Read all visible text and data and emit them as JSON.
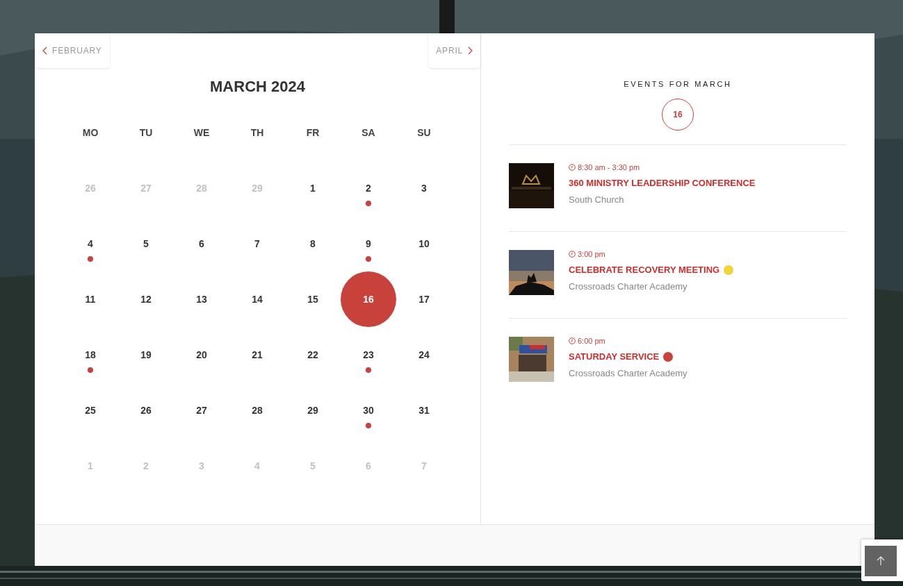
{
  "calendar": {
    "prev_month": "FEBRUARY",
    "next_month": "APRIL",
    "title": "MARCH 2024",
    "weekdays": [
      "MO",
      "TU",
      "WE",
      "TH",
      "FR",
      "SA",
      "SU"
    ],
    "weeks": [
      [
        {
          "day": "26",
          "muted": true,
          "selected": false,
          "has_event": false
        },
        {
          "day": "27",
          "muted": true,
          "selected": false,
          "has_event": false
        },
        {
          "day": "28",
          "muted": true,
          "selected": false,
          "has_event": false
        },
        {
          "day": "29",
          "muted": true,
          "selected": false,
          "has_event": false
        },
        {
          "day": "1",
          "muted": false,
          "selected": false,
          "has_event": false
        },
        {
          "day": "2",
          "muted": false,
          "selected": false,
          "has_event": true
        },
        {
          "day": "3",
          "muted": false,
          "selected": false,
          "has_event": false
        }
      ],
      [
        {
          "day": "4",
          "muted": false,
          "selected": false,
          "has_event": true
        },
        {
          "day": "5",
          "muted": false,
          "selected": false,
          "has_event": false
        },
        {
          "day": "6",
          "muted": false,
          "selected": false,
          "has_event": false
        },
        {
          "day": "7",
          "muted": false,
          "selected": false,
          "has_event": false
        },
        {
          "day": "8",
          "muted": false,
          "selected": false,
          "has_event": false
        },
        {
          "day": "9",
          "muted": false,
          "selected": false,
          "has_event": true
        },
        {
          "day": "10",
          "muted": false,
          "selected": false,
          "has_event": false
        }
      ],
      [
        {
          "day": "11",
          "muted": false,
          "selected": false,
          "has_event": false
        },
        {
          "day": "12",
          "muted": false,
          "selected": false,
          "has_event": false
        },
        {
          "day": "13",
          "muted": false,
          "selected": false,
          "has_event": false
        },
        {
          "day": "14",
          "muted": false,
          "selected": false,
          "has_event": false
        },
        {
          "day": "15",
          "muted": false,
          "selected": false,
          "has_event": false
        },
        {
          "day": "16",
          "muted": false,
          "selected": true,
          "has_event": true
        },
        {
          "day": "17",
          "muted": false,
          "selected": false,
          "has_event": false
        }
      ],
      [
        {
          "day": "18",
          "muted": false,
          "selected": false,
          "has_event": true
        },
        {
          "day": "19",
          "muted": false,
          "selected": false,
          "has_event": false
        },
        {
          "day": "20",
          "muted": false,
          "selected": false,
          "has_event": false
        },
        {
          "day": "21",
          "muted": false,
          "selected": false,
          "has_event": false
        },
        {
          "day": "22",
          "muted": false,
          "selected": false,
          "has_event": false
        },
        {
          "day": "23",
          "muted": false,
          "selected": false,
          "has_event": true
        },
        {
          "day": "24",
          "muted": false,
          "selected": false,
          "has_event": false
        }
      ],
      [
        {
          "day": "25",
          "muted": false,
          "selected": false,
          "has_event": false
        },
        {
          "day": "26",
          "muted": false,
          "selected": false,
          "has_event": false
        },
        {
          "day": "27",
          "muted": false,
          "selected": false,
          "has_event": false
        },
        {
          "day": "28",
          "muted": false,
          "selected": false,
          "has_event": false
        },
        {
          "day": "29",
          "muted": false,
          "selected": false,
          "has_event": false
        },
        {
          "day": "30",
          "muted": false,
          "selected": false,
          "has_event": true
        },
        {
          "day": "31",
          "muted": false,
          "selected": false,
          "has_event": false
        }
      ],
      [
        {
          "day": "1",
          "muted": true,
          "selected": false,
          "has_event": false
        },
        {
          "day": "2",
          "muted": true,
          "selected": false,
          "has_event": false
        },
        {
          "day": "3",
          "muted": true,
          "selected": false,
          "has_event": false
        },
        {
          "day": "4",
          "muted": true,
          "selected": false,
          "has_event": false
        },
        {
          "day": "5",
          "muted": true,
          "selected": false,
          "has_event": false
        },
        {
          "day": "6",
          "muted": true,
          "selected": false,
          "has_event": false
        },
        {
          "day": "7",
          "muted": true,
          "selected": false,
          "has_event": false
        }
      ]
    ]
  },
  "events_panel": {
    "heading": "EVENTS FOR MARCH",
    "day_badge": "16",
    "events": [
      {
        "time": "8:30 am - 3:30 pm",
        "title": "360 MINISTRY LEADERSHIP CONFERENCE",
        "location": "South Church"
      },
      {
        "time": "3:00 pm",
        "title": "CELEBRATE RECOVERY MEETING",
        "location": "Crossroads Charter Academy",
        "color": "#f2d338"
      },
      {
        "time": "6:00 pm",
        "title": "SATURDAY SERVICE",
        "location": "Crossroads Charter Academy",
        "color": "#c9413b"
      }
    ]
  }
}
